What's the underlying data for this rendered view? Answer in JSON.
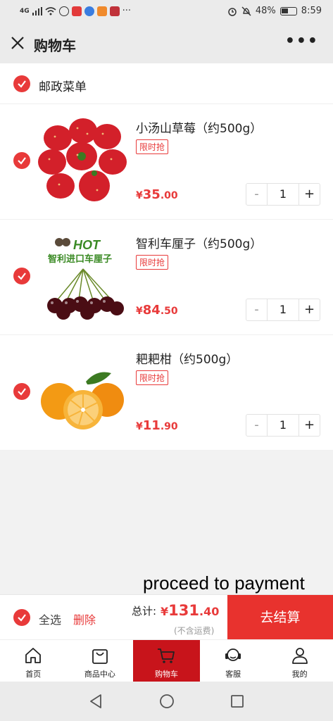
{
  "status_bar": {
    "network": "4G",
    "battery": "48%",
    "time": "8:59",
    "more": "···"
  },
  "header": {
    "title": "购物车",
    "more": "•••"
  },
  "shop": {
    "name": "邮政菜单"
  },
  "items": [
    {
      "name": "小汤山草莓（约500g）",
      "tag": "限时抢",
      "currency": "¥",
      "price_int": "35",
      "price_dec": ".00",
      "quantity": "1",
      "image": "strawberries"
    },
    {
      "name": "智利车厘子（约500g）",
      "tag": "限时抢",
      "currency": "¥",
      "price_int": "84",
      "price_dec": ".50",
      "quantity": "1",
      "image": "cherries",
      "image_text": {
        "hot": "HOT",
        "caption": "智利进口车厘子"
      }
    },
    {
      "name": "耙耙柑（约500g）",
      "tag": "限时抢",
      "currency": "¥",
      "price_int": "11",
      "price_dec": ".90",
      "quantity": "1",
      "image": "mandarin"
    }
  ],
  "stepper": {
    "minus": "-",
    "plus": "+"
  },
  "overlay": {
    "text": "proceed to payment"
  },
  "checkout": {
    "select_all": "全选",
    "delete": "删除",
    "total_label": "总计:",
    "currency": "¥",
    "total_int": "131",
    "total_dec": ".40",
    "shipping_note": "(不含运费)",
    "pay_button": "去结算"
  },
  "tabs": [
    {
      "label": "首页",
      "icon": "home-icon"
    },
    {
      "label": "商品中心",
      "icon": "shopping-bag-icon"
    },
    {
      "label": "购物车",
      "icon": "cart-icon",
      "active": true
    },
    {
      "label": "客服",
      "icon": "headset-icon"
    },
    {
      "label": "我的",
      "icon": "user-icon"
    }
  ],
  "colors": {
    "accent": "#e83a3a",
    "active_tab": "#c8141b",
    "pay_button": "#e8322e"
  }
}
